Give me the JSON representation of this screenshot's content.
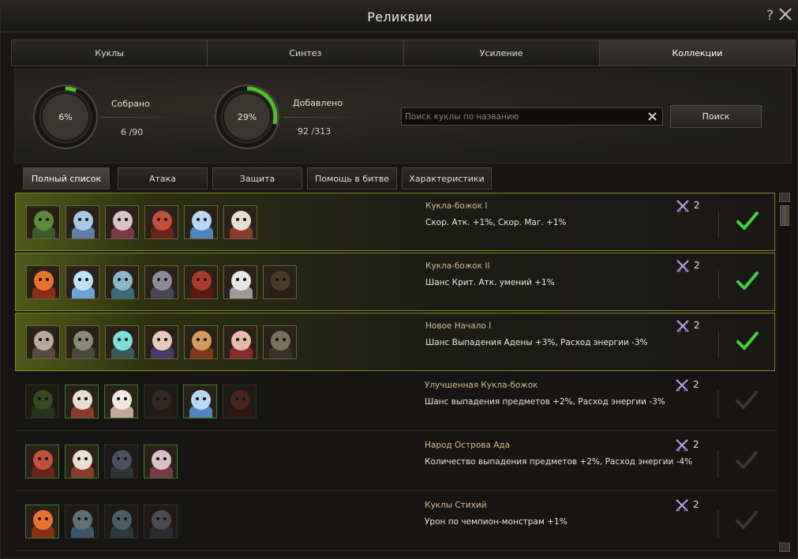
{
  "window": {
    "title": "Реликвии",
    "help": "?"
  },
  "tabs": [
    {
      "label": "Куклы",
      "active": false
    },
    {
      "label": "Синтез",
      "active": false
    },
    {
      "label": "Усиление",
      "active": false
    },
    {
      "label": "Коллекции",
      "active": true
    }
  ],
  "stats": {
    "collected": {
      "label": "Собрано",
      "percent_text": "6%",
      "percent": 6,
      "count": "6 /90"
    },
    "added": {
      "label": "Добавлено",
      "percent_text": "29%",
      "percent": 29,
      "count": "92 /313"
    }
  },
  "search": {
    "placeholder": "Поиск куклы по названию",
    "value": "",
    "button": "Поиск"
  },
  "filters": [
    {
      "label": "Полный список",
      "active": true
    },
    {
      "label": "Атака",
      "active": false
    },
    {
      "label": "Защита",
      "active": false
    },
    {
      "label": "Помощь в битве",
      "active": false
    },
    {
      "label": "Характеристики",
      "active": false
    }
  ],
  "collections": [
    {
      "name": "Кукла-божок I",
      "effect": "Скор. Атк. +1%, Скор. Маг. +1%",
      "count": "2",
      "completed": true,
      "dolls": [
        {
          "face": "#5f8a3a",
          "body": "#3c5c25",
          "dim": false
        },
        {
          "face": "#a9c8e6",
          "body": "#5d7fa8",
          "dim": false
        },
        {
          "face": "#d9c1c7",
          "body": "#7a3a45",
          "dim": false
        },
        {
          "face": "#c2503a",
          "body": "#6b2418",
          "dim": false
        },
        {
          "face": "#b8d8f5",
          "body": "#4f86c2",
          "dim": false
        },
        {
          "face": "#e8ddd0",
          "body": "#8a3b2e",
          "dim": false
        }
      ]
    },
    {
      "name": "Кукла-божок II",
      "effect": "Шанс Крит. Атк. умений +1%",
      "count": "2",
      "completed": true,
      "dolls": [
        {
          "face": "#e8732b",
          "body": "#8a2e14",
          "dim": false
        },
        {
          "face": "#bfe0f5",
          "body": "#6aa3d6",
          "dim": false
        },
        {
          "face": "#8ab8c8",
          "body": "#3d6a7a",
          "dim": false
        },
        {
          "face": "#8c8a96",
          "body": "#4a4755",
          "dim": false
        },
        {
          "face": "#b03a2a",
          "body": "#5a1a12",
          "dim": false
        },
        {
          "face": "#e8e4e0",
          "body": "#9a9a9a",
          "dim": false
        },
        {
          "face": "#4a3a2a",
          "body": "#2a1e14",
          "dim": false
        }
      ]
    },
    {
      "name": "Новое Начало I",
      "effect": "Шанс Выпадения Адены +3%, Расход энергии -3%",
      "count": "2",
      "completed": true,
      "dolls": [
        {
          "face": "#b8a89a",
          "body": "#5a4a3e",
          "dim": false
        },
        {
          "face": "#8a8a7a",
          "body": "#4a4a3e",
          "dim": false
        },
        {
          "face": "#7ae0d8",
          "body": "#3a5a58",
          "dim": false
        },
        {
          "face": "#e8c8b8",
          "body": "#4a3a6a",
          "dim": false
        },
        {
          "face": "#d89a5a",
          "body": "#7a3a18",
          "dim": false
        },
        {
          "face": "#e8b8a8",
          "body": "#8a2a2a",
          "dim": false
        },
        {
          "face": "#7a7060",
          "body": "#3a3228",
          "dim": false
        }
      ]
    },
    {
      "name": "Улучшенная Кукла-божок",
      "effect": "Шанс выпадения предметов +2%, Расход энергии -3%",
      "count": "2",
      "completed": false,
      "dolls": [
        {
          "face": "#5f8a3a",
          "body": "#3c5c25",
          "dim": true
        },
        {
          "face": "#e8ddd0",
          "body": "#8a3b2e",
          "dim": false
        },
        {
          "face": "#f0e8e0",
          "body": "#c4a89a",
          "dim": false
        },
        {
          "face": "#5a4030",
          "body": "#3a2418",
          "dim": true
        },
        {
          "face": "#b8d8f5",
          "body": "#4f86c2",
          "dim": false
        },
        {
          "face": "#8a3a2a",
          "body": "#4a1a12",
          "dim": true
        }
      ]
    },
    {
      "name": "Народ Острова Ада",
      "effect": "Количество выпадения предметов +2%, Расход энергии -4%",
      "count": "2",
      "completed": false,
      "dolls": [
        {
          "face": "#c2503a",
          "body": "#6b2418",
          "dim": false
        },
        {
          "face": "#e8ddd0",
          "body": "#8a3b2e",
          "dim": false
        },
        {
          "face": "#8aa0b8",
          "body": "#4a5a6a",
          "dim": true
        },
        {
          "face": "#d9c1c7",
          "body": "#7a3a45",
          "dim": false
        }
      ]
    },
    {
      "name": "Куклы Стихий",
      "effect": "Урон по чемпион-монстрам +1%",
      "count": "2",
      "completed": false,
      "dolls": [
        {
          "face": "#e8732b",
          "body": "#8a2e14",
          "dim": false
        },
        {
          "face": "#bfe0f5",
          "body": "#6aa3d6",
          "dim": true
        },
        {
          "face": "#8ab8c8",
          "body": "#3d6a7a",
          "dim": true
        },
        {
          "face": "#8c8a96",
          "body": "#4a4755",
          "dim": true
        }
      ]
    }
  ]
}
